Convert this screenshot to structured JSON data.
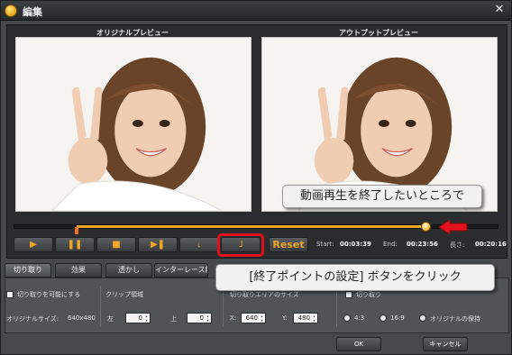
{
  "window": {
    "title": "編集",
    "close_label": "✕"
  },
  "preview": {
    "original_label": "オリジナルプレビュー",
    "output_label": "アウトプットプレビュー"
  },
  "callouts": {
    "top": "動画再生を終了したいところで",
    "bottom": "[終了ポイントの設定] ボタンをクリック"
  },
  "timeline": {
    "start_fraction": 0.13,
    "end_fraction": 0.85
  },
  "controls": {
    "play": "▶",
    "pause": "❚❚",
    "stop": "■",
    "next_frame": "▶❚",
    "set_start": "˪",
    "set_end": "˩",
    "reset": "Reset"
  },
  "times": {
    "start_label": "Start:",
    "start_value": "00:03:39",
    "end_label": "End:",
    "end_value": "00:23:56",
    "length_label": "長さ:",
    "length_value": "00:20:16"
  },
  "tabs": [
    "切り取り",
    "効果",
    "透かし",
    "インターレース解除"
  ],
  "crop": {
    "enable_label": "切り取りを可能にする",
    "original_size_label": "オリジナルサイズ:",
    "original_size_value": "640x480",
    "clip_area_label": "クリップ領域",
    "left_label": "左",
    "left_value": "0",
    "top_label": "上",
    "top_value": "0",
    "crop_size_label": "切り取りエリアのサイズ",
    "x_label": "X:",
    "x_value": "640",
    "y_label": "Y:",
    "y_value": "480",
    "crop_label": "切り取り",
    "ratio_43": "4:3",
    "ratio_169": "16:9",
    "ratio_keep": "オリジナルの保持"
  },
  "buttons": {
    "ok": "OK",
    "cancel": "キャンセル"
  }
}
